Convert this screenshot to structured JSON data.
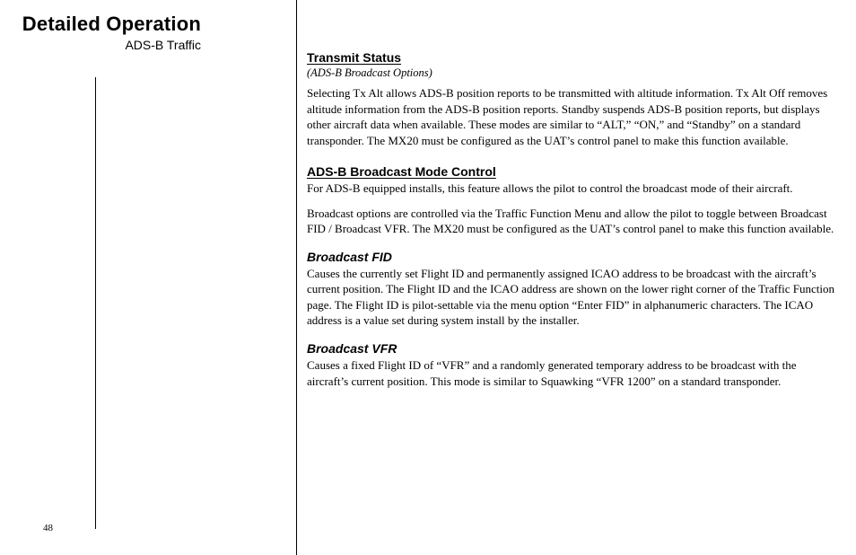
{
  "sidebar": {
    "title": "Detailed Operation",
    "subtitle": "ADS-B Traffic"
  },
  "page_number": "48",
  "main": {
    "s1": {
      "heading": "Transmit Status",
      "note": "(ADS-B Broadcast Options)",
      "para": "Selecting Tx Alt allows ADS-B position reports to be transmitted with altitude information. Tx Alt Off removes altitude information from the ADS-B position reports. Standby suspends ADS-B position reports, but displays other aircraft data when available. These modes are similar to “ALT,” “ON,” and “Standby” on a standard transponder. The MX20 must be configured as the UAT’s control panel to make this function available."
    },
    "s2": {
      "heading": "ADS-B Broadcast Mode Control",
      "para1": "For ADS-B equipped installs, this feature allows the pilot to control the broadcast mode of their aircraft.",
      "para2": "Broadcast options are controlled via the Traffic Function Menu and allow the pilot to toggle between Broadcast FID / Broadcast VFR. The MX20 must be configured as the UAT’s control panel to make this function available."
    },
    "s3": {
      "heading": "Broadcast FID",
      "para": "Causes the currently set Flight ID and permanently assigned ICAO address to be broadcast with the aircraft’s current position. The Flight ID and the ICAO address are shown on the lower right corner of the Traffic Function page. The Flight ID is pilot-settable via the menu option “Enter FID” in alphanumeric characters. The ICAO address is a value set during system install by the installer."
    },
    "s4": {
      "heading": "Broadcast VFR",
      "para": "Causes a fixed Flight ID of “VFR” and a randomly generated temporary address to be broadcast with the aircraft’s current position. This mode is similar to Squawking “VFR 1200” on a standard transponder."
    }
  }
}
